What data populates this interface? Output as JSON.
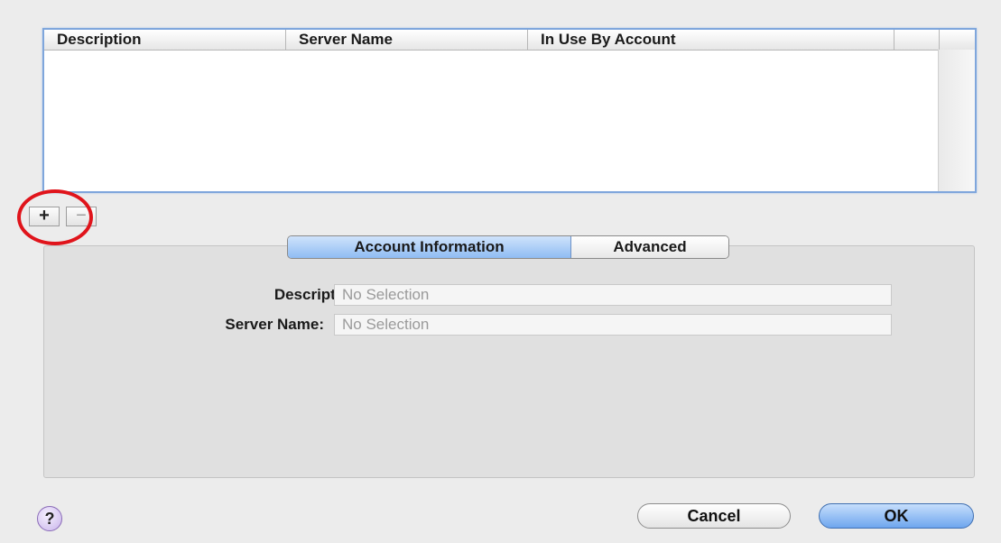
{
  "table": {
    "columns": [
      "Description",
      "Server Name",
      "In Use By Account",
      ""
    ]
  },
  "list_controls": {
    "add_label": "+",
    "remove_label": "−"
  },
  "tabs": {
    "account_information": "Account Information",
    "advanced": "Advanced"
  },
  "form": {
    "description_label": "Description:",
    "description_value": "No Selection",
    "server_name_label": "Server Name:",
    "server_name_value": "No Selection"
  },
  "buttons": {
    "help": "?",
    "cancel": "Cancel",
    "ok": "OK"
  },
  "colors": {
    "highlight_circle": "#e0141b",
    "default_button": "#6ea6ee"
  }
}
